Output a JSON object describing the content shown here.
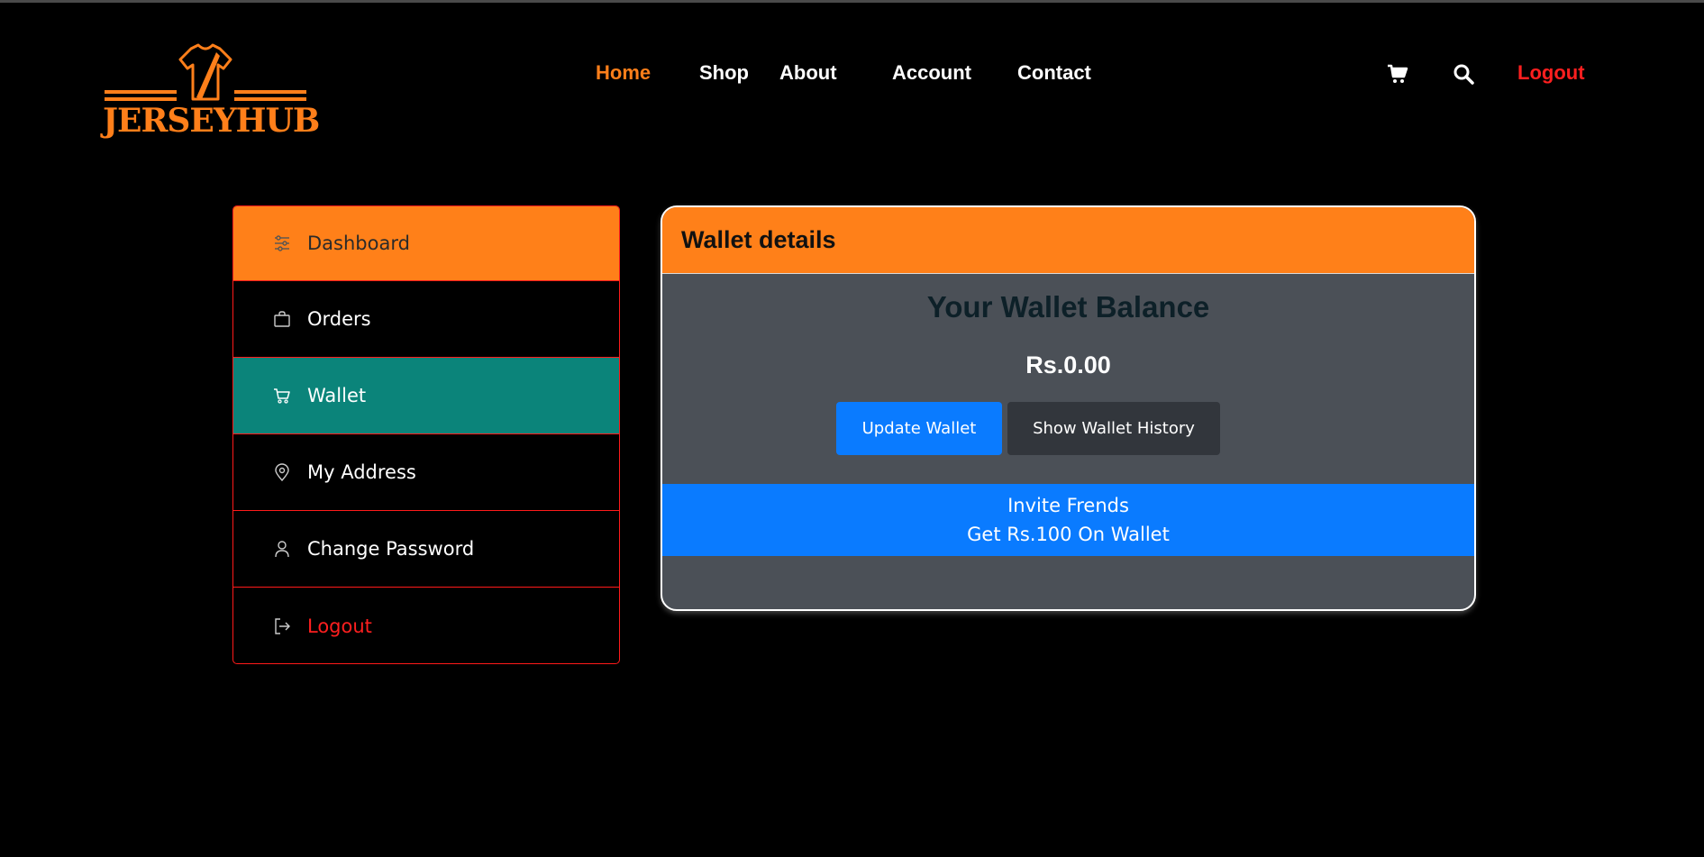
{
  "brand": {
    "name": "JERSEYHUB",
    "accent": "#ff7f1a"
  },
  "nav": {
    "links": [
      {
        "label": "Home",
        "active": true
      },
      {
        "label": "Shop"
      },
      {
        "label": "About"
      },
      {
        "label": "Account"
      },
      {
        "label": "Contact"
      }
    ],
    "icons": [
      "cart-icon",
      "search-icon"
    ],
    "logout": "Logout"
  },
  "sidebar": {
    "items": [
      {
        "label": "Dashboard",
        "icon": "sliders-icon"
      },
      {
        "label": "Orders",
        "icon": "bag-icon"
      },
      {
        "label": "Wallet",
        "icon": "cart-icon",
        "active": true
      },
      {
        "label": "My Address",
        "icon": "location-pin-icon"
      },
      {
        "label": "Change Password",
        "icon": "user-icon"
      },
      {
        "label": "Logout",
        "icon": "sign-out-icon"
      }
    ]
  },
  "wallet": {
    "header": "Wallet details",
    "balance_title": "Your Wallet Balance",
    "balance": "Rs.0.00",
    "update_button": "Update Wallet",
    "history_button": "Show Wallet History",
    "invite_line1": "Invite Frends",
    "invite_line2": "Get Rs.100 On Wallet"
  },
  "colors": {
    "orange": "#ff8019",
    "teal": "#0b847a",
    "red": "#ff1f1f",
    "blue": "#0a7bff",
    "card": "#4b5057"
  }
}
